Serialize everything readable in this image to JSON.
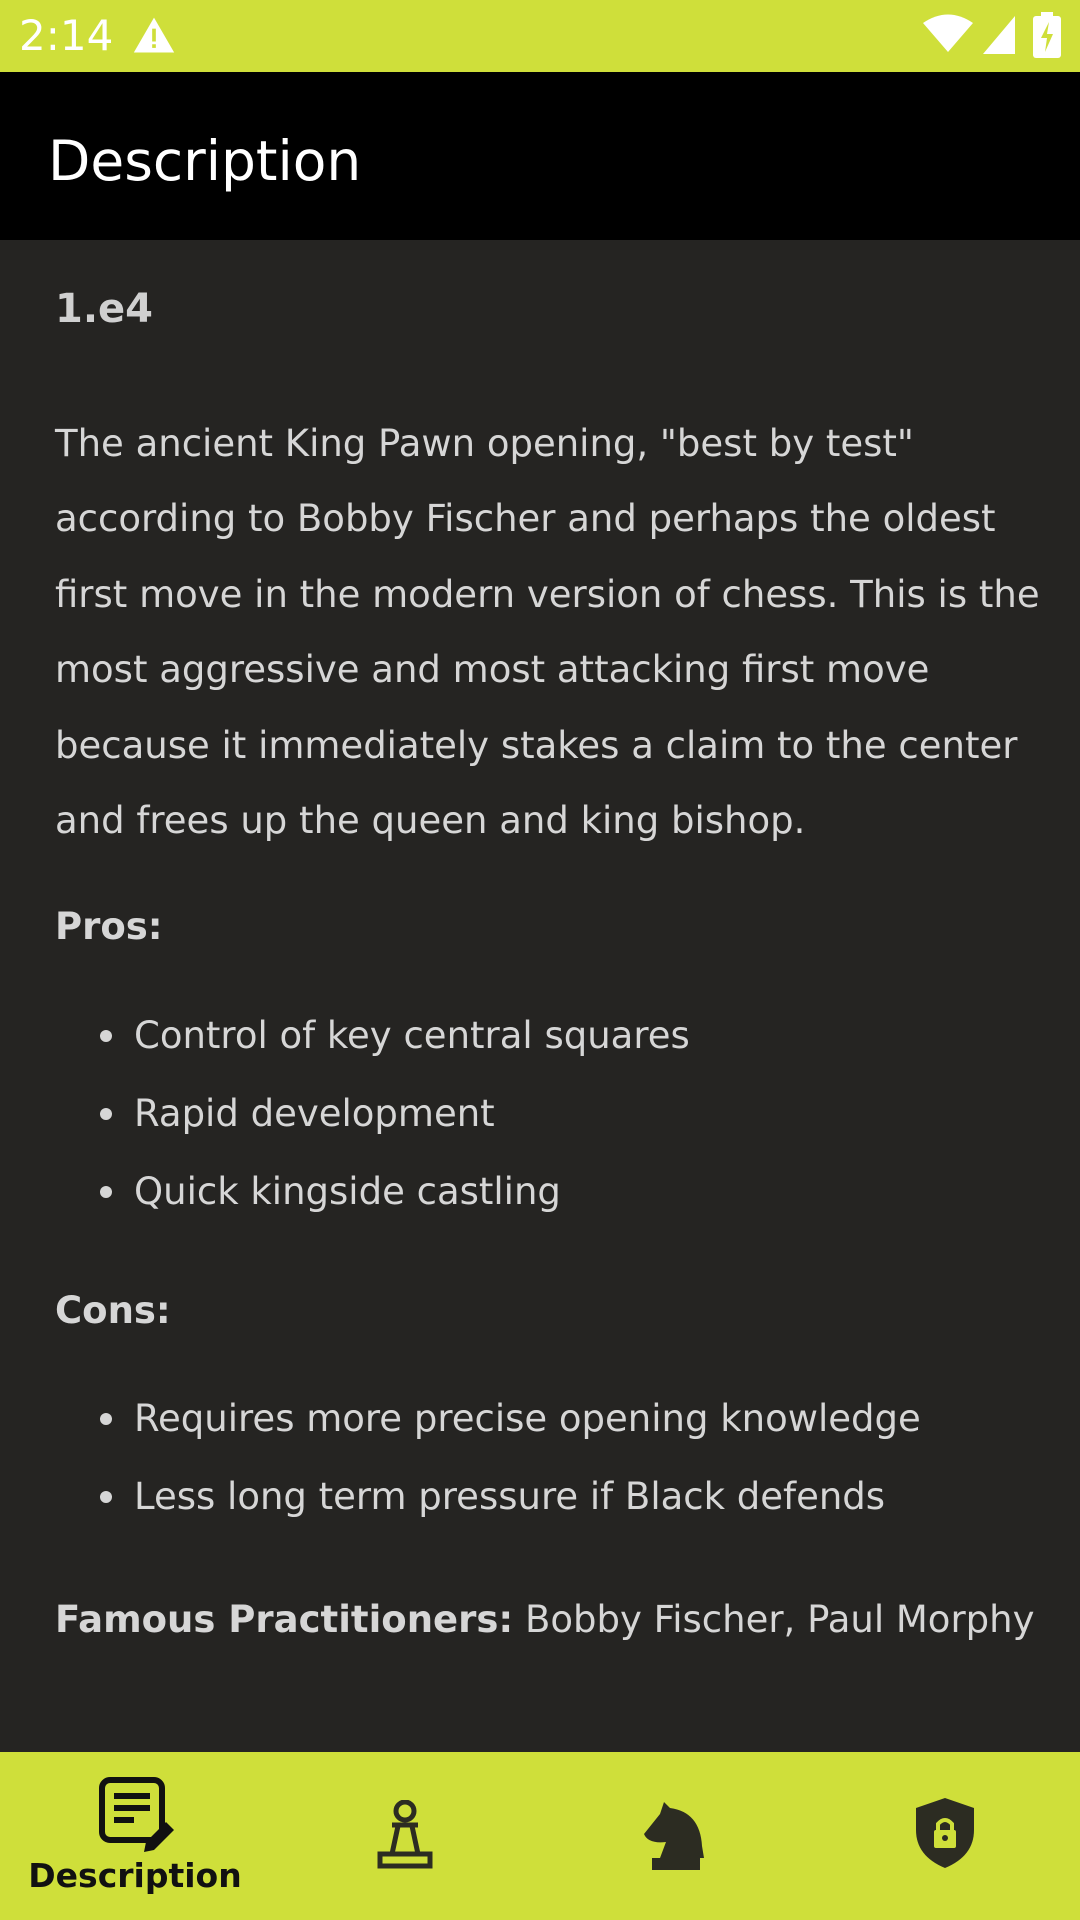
{
  "status_bar": {
    "time": "2:14"
  },
  "app_bar": {
    "title": "Description"
  },
  "content": {
    "move": "1.e4",
    "intro": "The ancient King Pawn opening, \"best by test\" according to Bobby Fischer and perhaps the oldest first move in the modern version of chess. This is the most aggressive and most attacking first move because it immediately stakes a claim to the center and frees up the queen and king bishop.",
    "pros_label": "Pros:",
    "pros": [
      "Control of key central squares",
      "Rapid development",
      "Quick kingside castling"
    ],
    "cons_label": "Cons:",
    "cons": [
      "Requires more precise opening knowledge",
      "Less long term pressure if Black defends"
    ],
    "famous_label": "Famous Practitioners:",
    "famous_value": " Bobby Fischer, Paul Morphy"
  },
  "bottom_nav": {
    "items": [
      {
        "label": "Description",
        "icon": "description-icon",
        "selected": true
      },
      {
        "icon": "pawn-icon"
      },
      {
        "icon": "knight-icon"
      },
      {
        "icon": "shield-lock-icon"
      }
    ]
  },
  "colors": {
    "accent": "#cfdf3a",
    "app_bar": "#000000",
    "background": "#252422",
    "text": "#d6d6d6"
  }
}
